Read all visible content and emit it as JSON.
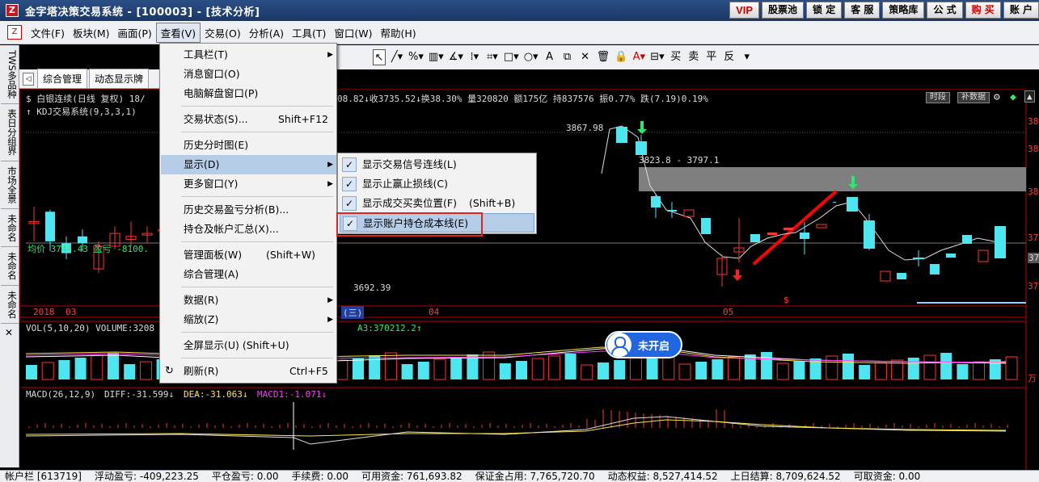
{
  "window": {
    "logo_glyph": "Z",
    "title": "金字塔决策交易系统 - [100003] - [技术分析]",
    "buttons": [
      "VIP",
      "股票池",
      "锁 定",
      "客 服",
      "策略库",
      "公 式",
      "购 买",
      "账 户"
    ]
  },
  "menubar": {
    "icon_glyph": "Z",
    "items": [
      "文件(F)",
      "板块(M)",
      "画面(P)",
      "查看(V)",
      "交易(O)",
      "分析(A)",
      "工具(T)",
      "窗口(W)",
      "帮助(H)"
    ],
    "active_index": 3
  },
  "drawbar": {
    "tools": [
      "cursor-icon",
      "line-icon",
      "percent-icon",
      "ruler-icon",
      "angle-icon",
      "vertical-lines-icon",
      "grid-icon",
      "rect-icon",
      "circle-icon",
      "text-icon",
      "copy-icon",
      "delete-icon",
      "trash-icon",
      "lock-icon",
      "font-color-icon",
      "save-icon"
    ],
    "tool_glyphs": [
      "↖",
      "╱▾",
      "%▾",
      "▥▾",
      "∡▾",
      "⁞▾",
      "⌗▾",
      "□▾",
      "○▾",
      "A",
      "⧉",
      "✕",
      "🗑",
      "🔒",
      "A▾",
      "⊟▾"
    ],
    "text_tools": [
      "买",
      "卖",
      "平",
      "反"
    ],
    "more": "▾"
  },
  "left_tabs": [
    "TWS多品种",
    "表日分组界",
    "市场全景",
    "未命名",
    "未命名",
    "未命名"
  ],
  "left_close": "✕",
  "tabs": {
    "arrow": "◁",
    "items": [
      "综合管理",
      "动态显示牌"
    ]
  },
  "chart": {
    "header_line1_left": "$ 白银连续(日线 复权) 18/",
    "header_line1_right": "08.82↓收3735.52↓换38.30% 量320820 额175亿 持837576 振0.77% 跌(7.19)0.19%",
    "header_line2": "↑ KDJ交易系统(9,3,3,1)",
    "avg_line": "均价 3744.43 盈亏 -8100.",
    "price_high": "3867.98",
    "price_low": "3692.39",
    "range_label": "3823.8 - 3797.1",
    "time_btn": "时段",
    "fill_btn": "补数据",
    "x_labels": [
      "2018",
      "03",
      "04",
      "05"
    ],
    "mid_label": "(三)",
    "dollar_mark": "$",
    "vol_header": "VOL(5,10,20) VOLUME:3208",
    "vol_header_right": "A3:370212.2↑",
    "macd_title": "MACD(26,12,9)",
    "macd_diff": "DIFF:-31.599↓",
    "macd_dea": "DEA:-31.063↓",
    "macd1": "MACD1:-1.071↓",
    "right_axis": [
      "38",
      "38",
      "38",
      "37",
      "37",
      "37",
      "37"
    ],
    "right_tag": "37",
    "right_vol": "万",
    "pill_text": "未开启"
  },
  "chart_data": {
    "type": "candlestick",
    "candles": [
      {
        "o": 3760,
        "c": 3758,
        "h": 3775,
        "l": 3740,
        "up": true
      },
      {
        "o": 3770,
        "c": 3740,
        "h": 3772,
        "l": 3730,
        "up": false
      },
      {
        "o": 3738,
        "c": 3728,
        "h": 3745,
        "l": 3722,
        "up": false
      },
      {
        "o": 3745,
        "c": 3738,
        "h": 3752,
        "l": 3730,
        "up": false
      },
      {
        "o": 3712,
        "c": 3735,
        "h": 3740,
        "l": 3708,
        "up": true
      },
      {
        "o": 3735,
        "c": 3748,
        "h": 3755,
        "l": 3732,
        "up": true
      },
      {
        "o": 3742,
        "c": 3745,
        "h": 3760,
        "l": 3735,
        "up": true
      },
      {
        "o": 3748,
        "c": 3748,
        "h": 3755,
        "l": 3738,
        "up": true
      },
      {
        "o": 3752,
        "c": 3752,
        "h": 3762,
        "l": 3748,
        "up": true
      },
      {
        "o": 3780,
        "c": 3760,
        "h": 3785,
        "l": 3752,
        "up": true
      },
      {
        "o": 3764,
        "c": 3760,
        "h": 3768,
        "l": 3745,
        "up": false
      }
    ]
  },
  "dropdown": {
    "items": [
      {
        "label": "工具栏(T)",
        "shortcut": "",
        "arrow": true
      },
      {
        "label": "消息窗口(O)",
        "shortcut": "",
        "arrow": false
      },
      {
        "label": "电脑解盘窗口(P)",
        "shortcut": "",
        "arrow": false
      },
      {
        "label": "交易状态(S)...",
        "shortcut": "Shift+F12",
        "arrow": false
      },
      {
        "label": "历史分时图(E)",
        "shortcut": "",
        "arrow": false
      },
      {
        "label": "显示(D)",
        "shortcut": "",
        "arrow": true
      },
      {
        "label": "更多窗口(Y)",
        "shortcut": "",
        "arrow": true
      },
      {
        "label": "历史交易盈亏分析(B)...",
        "shortcut": "",
        "arrow": false
      },
      {
        "label": "持仓及帐户汇总(X)...",
        "shortcut": "",
        "arrow": false
      },
      {
        "label": "管理面板(W)",
        "shortcut": "(Shift+W)",
        "arrow": false
      },
      {
        "label": "综合管理(A)",
        "shortcut": "",
        "arrow": false
      },
      {
        "label": "数据(R)",
        "shortcut": "",
        "arrow": true
      },
      {
        "label": "缩放(Z)",
        "shortcut": "",
        "arrow": true
      },
      {
        "label": "全屏显示(U) (Shift+U)",
        "shortcut": "",
        "arrow": false
      },
      {
        "label": "刷新(R)",
        "shortcut": "Ctrl+F5",
        "arrow": false
      }
    ],
    "arrow_glyph": "▶",
    "refresh_icon": "↻"
  },
  "submenu": {
    "check_glyph": "✓",
    "items": [
      {
        "label": "显示交易信号连线(L)",
        "shortcut": "",
        "checked": true
      },
      {
        "label": "显示止赢止损线(C)",
        "shortcut": "",
        "checked": true
      },
      {
        "label": "显示成交买卖位置(F)",
        "shortcut": "(Shift+B)",
        "checked": true
      },
      {
        "label": "显示账户持仓成本线(E)",
        "shortcut": "",
        "checked": true
      }
    ]
  },
  "statusbar": [
    "帐户栏 [613719]",
    "浮动盈亏: -409,223.25",
    "平仓盈亏: 0.00",
    "手续费: 0.00",
    "可用资金: 761,693.82",
    "保证金占用: 7,765,720.70",
    "动态权益: 8,527,414.52",
    "上日结算: 8,709,624.52",
    "可取资金: 0.00"
  ]
}
